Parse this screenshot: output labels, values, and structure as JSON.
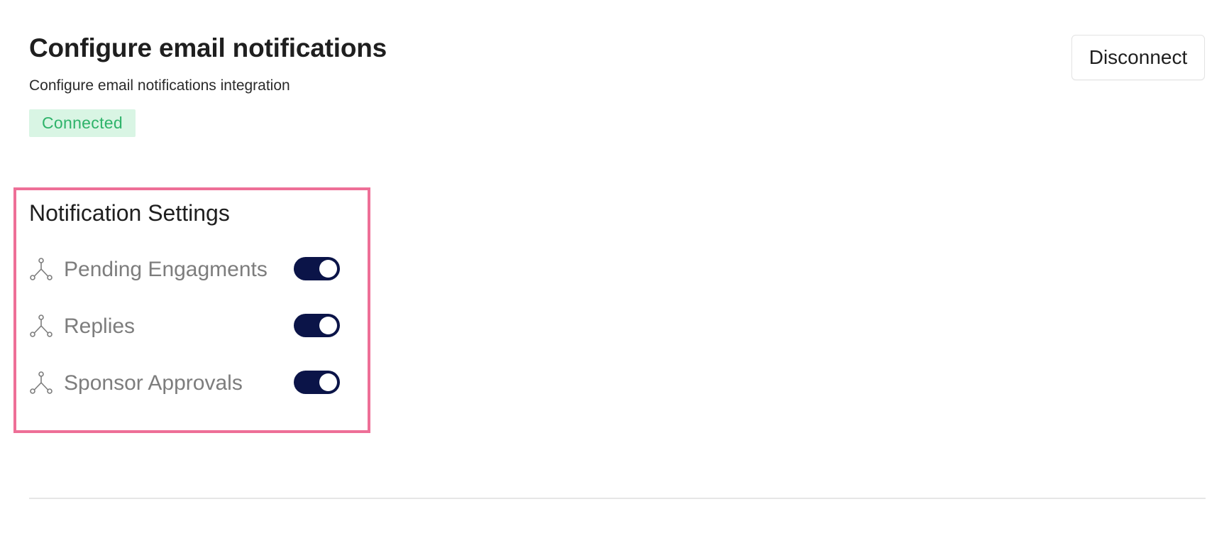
{
  "header": {
    "title": "Configure email notifications",
    "subtitle": "Configure email notifications integration",
    "status_badge": "Connected",
    "disconnect_label": "Disconnect"
  },
  "settings": {
    "title": "Notification Settings",
    "items": [
      {
        "label": "Pending Engagments",
        "icon": "nodes-icon",
        "enabled": true
      },
      {
        "label": "Replies",
        "icon": "nodes-icon",
        "enabled": true
      },
      {
        "label": "Sponsor Approvals",
        "icon": "nodes-icon",
        "enabled": true
      }
    ]
  },
  "colors": {
    "accent_toggle": "#0b1448",
    "status_green": "#2eb36a",
    "status_bg": "#d9f5e4",
    "highlight_border": "#ee6f97"
  }
}
